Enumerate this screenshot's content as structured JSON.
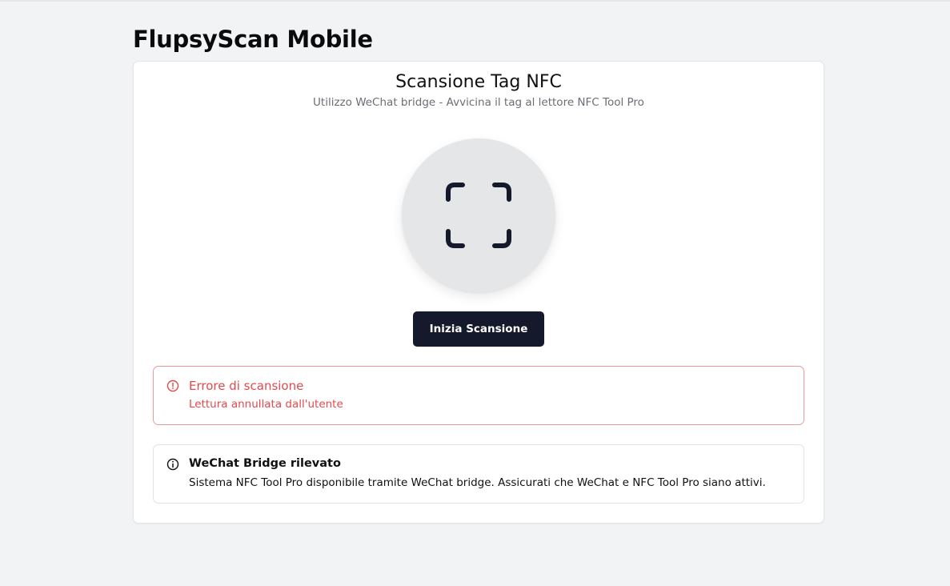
{
  "app": {
    "title": "FlupsyScan Mobile"
  },
  "scan_card": {
    "title": "Scansione Tag NFC",
    "subtitle": "Utilizzo WeChat bridge - Avvicina il tag al lettore NFC Tool Pro",
    "icon": "scan-frame-icon",
    "button_label": "Inizia Scansione"
  },
  "error_alert": {
    "icon": "alert-circle-icon",
    "title": "Errore di scansione",
    "description": "Lettura annullata dall'utente"
  },
  "info_alert": {
    "icon": "info-icon",
    "title": "WeChat Bridge rilevato",
    "description": "Sistema NFC Tool Pro disponibile tramite WeChat bridge. Assicurati che WeChat e NFC Tool Pro siano attivi."
  },
  "colors": {
    "page_background": "#f2f3f5",
    "button_background": "#141a2b",
    "error": "#e5484d",
    "error_border": "#ef9a9a"
  }
}
